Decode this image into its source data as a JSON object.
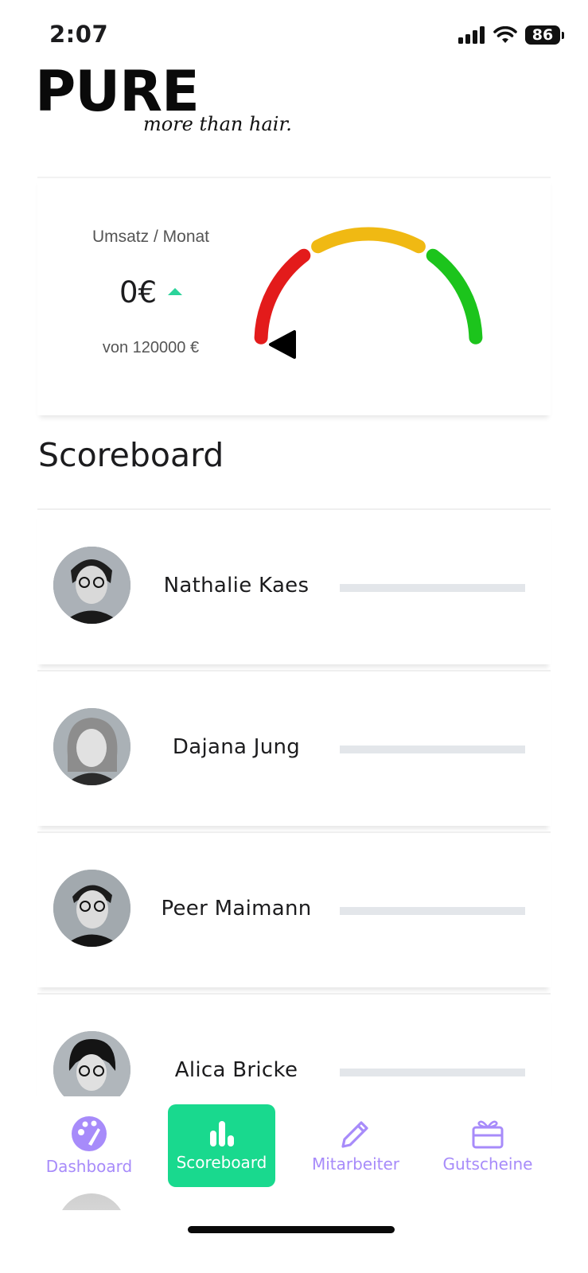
{
  "status_bar": {
    "time": "2:07",
    "battery": "86"
  },
  "logo": {
    "word": "PURE",
    "tagline": "more than hair."
  },
  "revenue": {
    "label": "Umsatz / Monat",
    "value": "0€",
    "target": "von 120000 €",
    "trend": "up",
    "gauge_fraction": 0,
    "gauge_colors": [
      "#e31b1b",
      "#f0b913",
      "#1cc41c"
    ]
  },
  "scoreboard": {
    "title": "Scoreboard",
    "people": [
      {
        "name": "Nathalie Kaes",
        "progress": 0
      },
      {
        "name": "Dajana Jung",
        "progress": 0
      },
      {
        "name": "Peer Maimann",
        "progress": 0
      },
      {
        "name": "Alica Bricke",
        "progress": 0
      }
    ]
  },
  "tabs": [
    {
      "label": "Dashboard",
      "icon": "palette-icon",
      "active": false
    },
    {
      "label": "Scoreboard",
      "icon": "bar-chart-icon",
      "active": true
    },
    {
      "label": "Mitarbeiter",
      "icon": "pencil-icon",
      "active": false
    },
    {
      "label": "Gutscheine",
      "icon": "gift-card-icon",
      "active": false
    }
  ],
  "colors": {
    "accent": "#19d98e",
    "tab_inactive": "#a78bfa",
    "trend_up": "#2bd39a"
  }
}
